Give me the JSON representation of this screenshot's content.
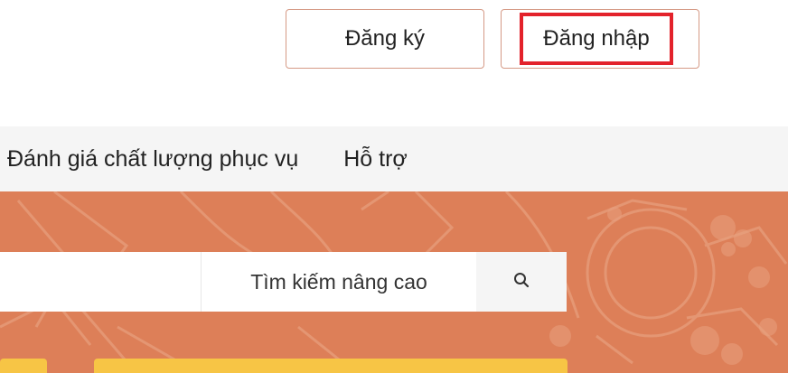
{
  "header": {
    "register_label": "Đăng ký",
    "login_label": "Đăng nhập"
  },
  "nav": {
    "items": [
      {
        "label": "Đánh giá chất lượng phục vụ"
      },
      {
        "label": "Hỗ trợ"
      }
    ]
  },
  "search": {
    "value": "",
    "advanced_label": "Tìm kiếm nâng cao",
    "search_icon": "search-icon"
  },
  "colors": {
    "hero_background": "#dd7f58",
    "highlight_border": "#e3222b",
    "button_border": "#d59a86",
    "accent_yellow": "#f7c545"
  }
}
